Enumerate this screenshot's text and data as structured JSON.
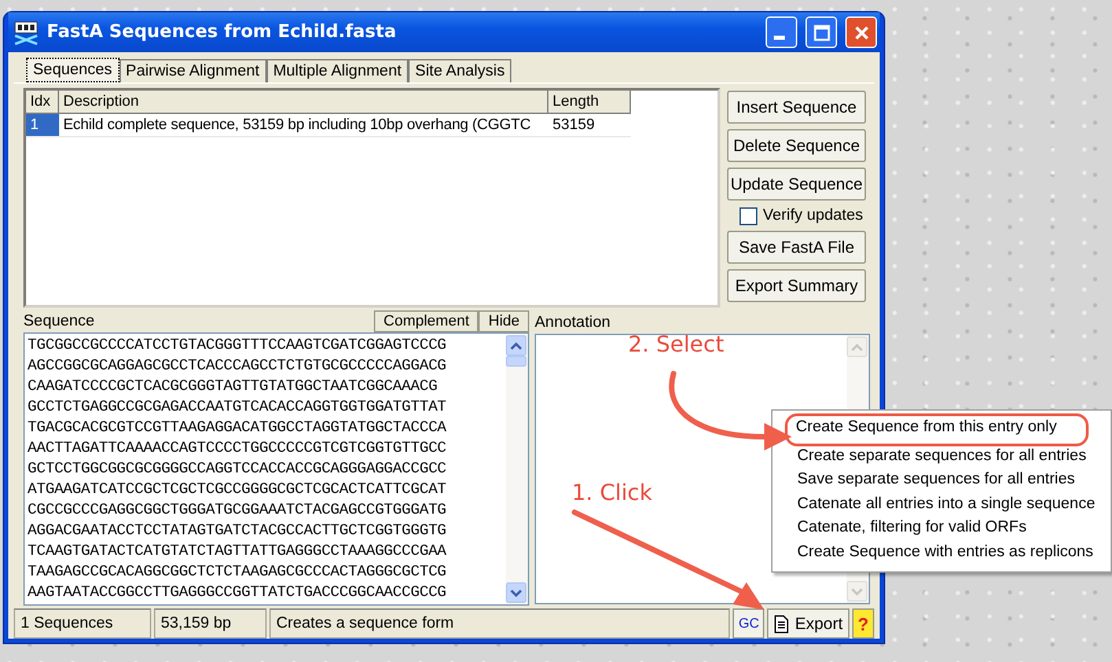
{
  "window": {
    "title": "FastA Sequences from Echild.fasta"
  },
  "tabs": [
    {
      "label": "Sequences",
      "selected": true
    },
    {
      "label": "Pairwise Alignment",
      "selected": false
    },
    {
      "label": "Multiple Alignment",
      "selected": false
    },
    {
      "label": "Site Analysis",
      "selected": false
    }
  ],
  "table": {
    "columns": [
      "Idx",
      "Description",
      "Length"
    ],
    "rows": [
      {
        "cells": [
          "1",
          "Echild complete sequence, 53159 bp including 10bp overhang (CGGTC",
          "53159"
        ],
        "selected": true
      }
    ]
  },
  "buttons": [
    "Insert Sequence",
    "Delete Sequence",
    "Update Sequence"
  ],
  "verify_checkbox": {
    "label": "Verify updates",
    "checked": false
  },
  "buttons_lower": [
    "Save FastA File",
    "Export Summary"
  ],
  "sequence_panel": {
    "title": "Sequence",
    "buttons": [
      "Complement",
      "Hide"
    ],
    "lines": [
      "TGCGGCCGCCCCATCCTGTACGGGTTTCCAAGTCGATCGGAGTCCCG",
      "AGCCGGCGCAGGAGCGCCTCACCCAGCCTCTGTGCGCCCCCAGGACG",
      "CAAGATCCCCGCTCACGCGGGTAGTTGTATGGCTAATCGGCAAACG",
      "GCCTCTGAGGCCGCGAGACCAATGTCACACCAGGTGGTGGATGTTAT",
      "TGACGCACGCGTCCGTTAAGAGGACATGGCCTAGGTATGGCTACCCA",
      "AACTTAGATTCAAAACCAGTCCCCTGGCCCCCGTCGTCGGTGTTGCC",
      "GCTCCTGGCGGCGCGGGGCCAGGTCCACCACCGCAGGGAGGACCGCC",
      "ATGAAGATCATCCGCTCGCTCGCCGGGGCGCTCGCACTCATTCGCAT",
      "CGCCGCCCGAGGCGGCTGGGATGCGGAAATCTACGAGCCGTGGGATG",
      "AGGACGAATACCTCCTATAGTGATCTACGCCACTTGCTCGGTGGGTG",
      "TCAAGTGATACTCATGTATCTAGTTATTGAGGGCCTAAAGGCCCGAA",
      "TAAGAGCCGCACAGGCGGCTCTCTAAGAGCGCCCACTAGGGCGCTCG",
      "AAGTAATACCGGCCTTGAGGGCCGGTTATCTGACCCGGCAACCGCCG"
    ]
  },
  "annotation_panel": {
    "title": "Annotation"
  },
  "status_bar": [
    "1 Sequences",
    "53,159 bp",
    "Creates a sequence form"
  ],
  "status_buttons": {
    "gc": "GC",
    "export": "Export",
    "help": "?"
  },
  "context_menu": {
    "items": [
      {
        "label": "Create Sequence from this entry only",
        "circled": true
      },
      {
        "label": "Create separate sequences for all entries",
        "circled": false
      },
      {
        "label": "Save separate sequences for all entries",
        "circled": false
      },
      {
        "label": "Catenate all entries into a single sequence",
        "circled": false
      },
      {
        "label": "Catenate, filtering for valid ORFs",
        "circled": false
      },
      {
        "label": "Create Sequence with entries as replicons",
        "circled": false
      }
    ]
  },
  "callouts": [
    {
      "text": "2. Select",
      "kind": "curved"
    },
    {
      "text": "1. Click",
      "kind": "straight"
    }
  ]
}
